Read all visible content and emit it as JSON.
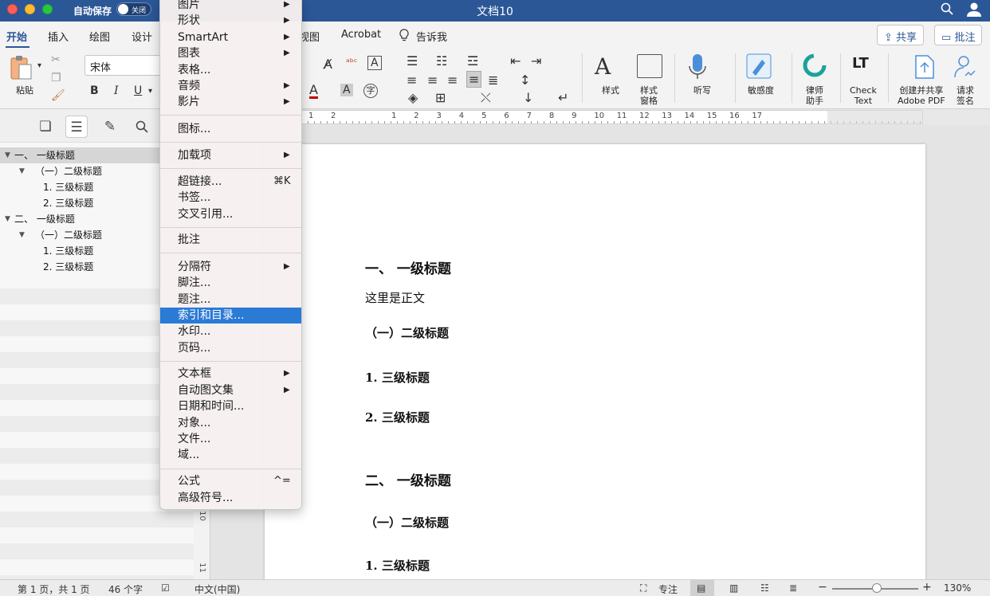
{
  "window": {
    "title": "文档10",
    "autosave_label": "自动保存",
    "autosave_state": "关闭"
  },
  "ribbon_tabs": {
    "home": "开始",
    "insert": "插入",
    "draw": "绘图",
    "design": "设计",
    "view": "视图",
    "acrobat": "Acrobat",
    "tell_me": "告诉我"
  },
  "top_buttons": {
    "share": "共享",
    "comment": "批注"
  },
  "ribbon": {
    "paste": "粘贴",
    "font_name": "宋体",
    "bold": "B",
    "italic": "I",
    "underline": "U",
    "styles": "样式",
    "styles_pane_line1": "样式",
    "styles_pane_line2": "窗格",
    "dictate": "听写",
    "sensitivity": "敏感度",
    "lawyer_line1": "律师",
    "lawyer_line2": "助手",
    "check_line1": "Check",
    "check_line2": "Text",
    "adobe_line1": "创建并共享",
    "adobe_line2": "Adobe PDF",
    "sign_line1": "请求",
    "sign_line2": "签名"
  },
  "outline": [
    {
      "label": "一、 一级标题",
      "level": 1,
      "selected": true
    },
    {
      "label": "（一）二级标题",
      "level": 2,
      "selected": false
    },
    {
      "label": "1. 三级标题",
      "level": 3,
      "selected": false
    },
    {
      "label": "2. 三级标题",
      "level": 3,
      "selected": false
    },
    {
      "label": "二、 一级标题",
      "level": 1,
      "selected": false
    },
    {
      "label": "（一）二级标题",
      "level": 2,
      "selected": false
    },
    {
      "label": "1. 三级标题",
      "level": 3,
      "selected": false
    },
    {
      "label": "2. 三级标题",
      "level": 3,
      "selected": false
    }
  ],
  "ruler_numbers": [
    "1",
    "2",
    "1",
    "2",
    "3",
    "4",
    "5",
    "6",
    "7",
    "8",
    "9",
    "10",
    "11",
    "12",
    "13",
    "14",
    "15",
    "16",
    "17"
  ],
  "vruler_numbers": [
    "10",
    "11"
  ],
  "document": {
    "h1_a": "一、  一级标题",
    "body": "这里是正文",
    "h2_a": "（一）二级标题",
    "h3_a": "1.  三级标题",
    "h3_b": "2.  三级标题",
    "h1_b": "二、  一级标题",
    "h2_b": "（一）二级标题",
    "h3_c": "1.  三级标题"
  },
  "menu": {
    "items": {
      "picture": "图片",
      "shape": "形状",
      "smartart": "SmartArt",
      "chart": "图表",
      "table": "表格...",
      "audio": "音频",
      "movie": "影片",
      "icons": "图标...",
      "addins": "加载项",
      "hyperlink": "超链接...",
      "hyperlink_shortcut": "⌘K",
      "bookmark": "书签...",
      "crossref": "交叉引用...",
      "comment": "批注",
      "break": "分隔符",
      "footnote": "脚注...",
      "caption": "题注...",
      "index_toc": "索引和目录...",
      "watermark": "水印...",
      "page_number": "页码...",
      "textbox": "文本框",
      "autotext": "自动图文集",
      "datetime": "日期和时间...",
      "object": "对象...",
      "file": "文件...",
      "field": "域...",
      "equation": "公式",
      "equation_shortcut": "^=",
      "symbol": "高级符号..."
    },
    "highlighted": "索引和目录..."
  },
  "statusbar": {
    "page": "第 1 页，共 1 页",
    "words": "46 个字",
    "language": "中文(中国)",
    "focus": "专注",
    "zoom": "130%"
  }
}
